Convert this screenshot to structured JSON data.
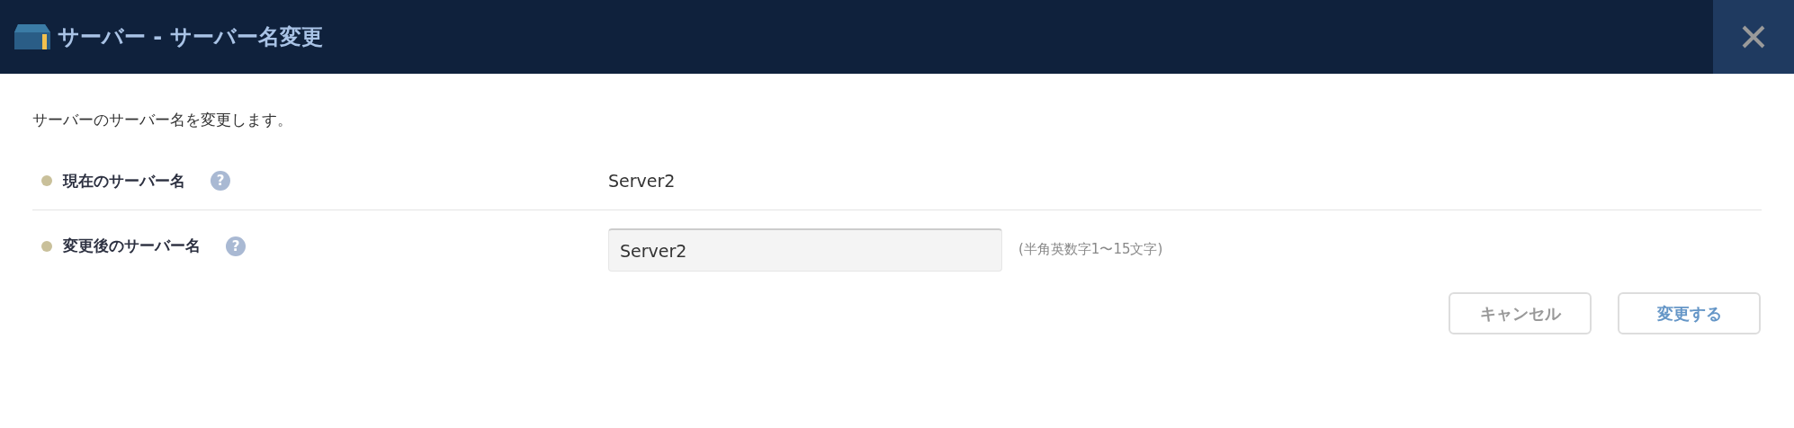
{
  "window": {
    "title": "サーバー - サーバー名変更"
  },
  "description": "サーバーのサーバー名を変更します。",
  "fields": [
    {
      "kind": "text",
      "label": "現在のサーバー名",
      "help": "?",
      "value": "Server2"
    },
    {
      "kind": "input",
      "label": "変更後のサーバー名",
      "help": "?",
      "value": "Server2",
      "hint": "(半角英数字1〜15文字)"
    }
  ],
  "buttons": [
    {
      "label": "キャンセル",
      "kind": "secondary"
    },
    {
      "label": "変更する",
      "kind": "primary"
    }
  ]
}
